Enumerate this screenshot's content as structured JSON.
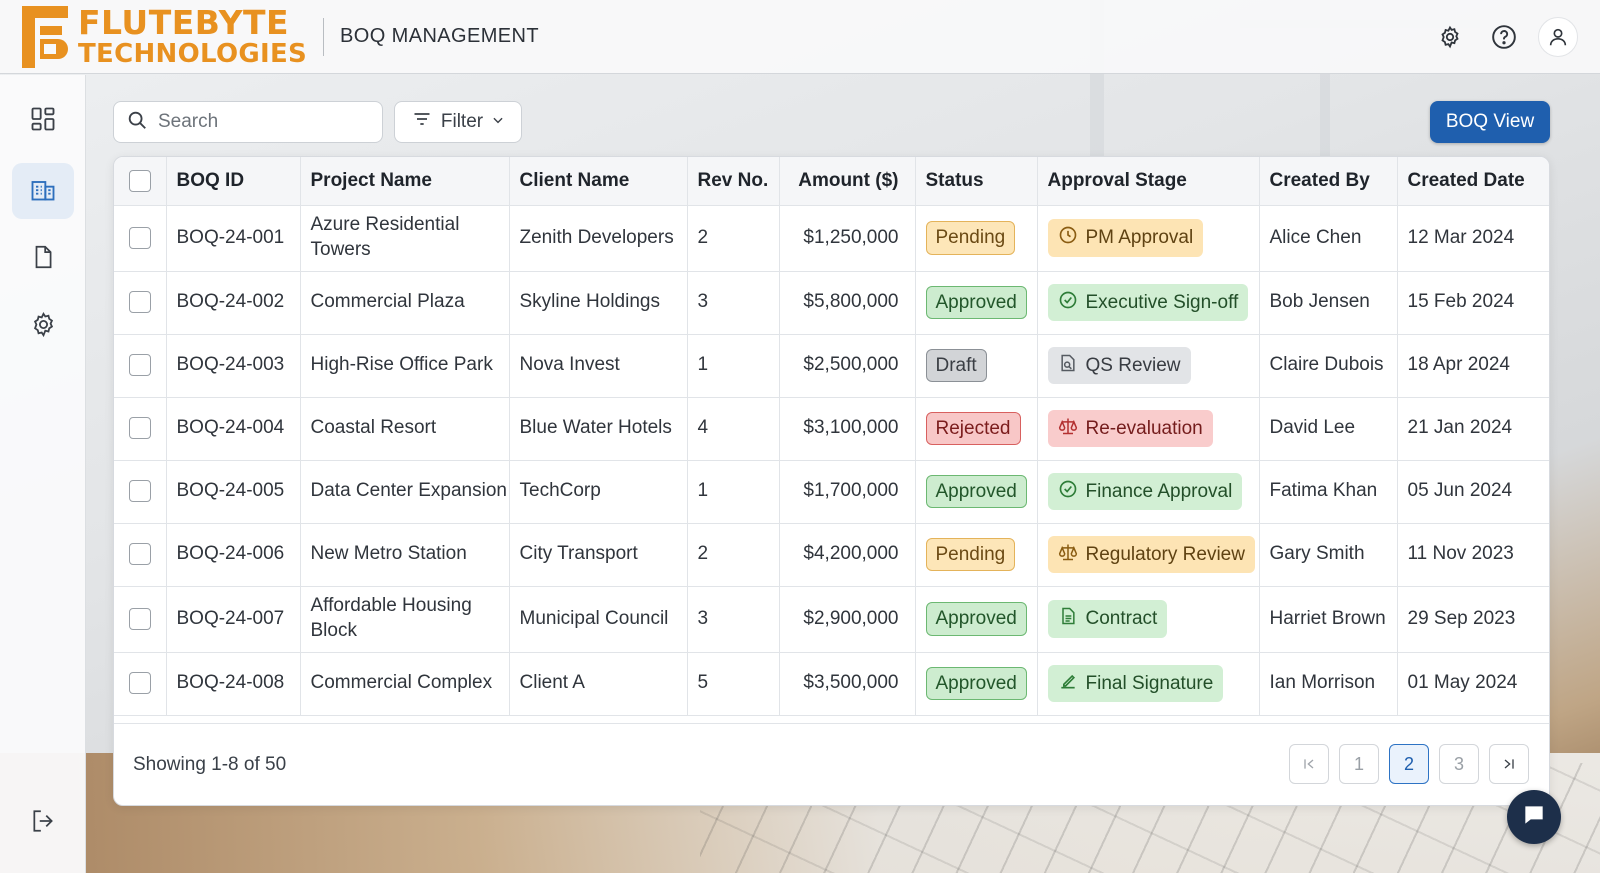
{
  "brand": {
    "line1": "FLUTEBYTE",
    "line2": "TECHNOLOGIES",
    "color": "#e89120"
  },
  "header": {
    "title": "BOQ MANAGEMENT",
    "icons": [
      "settings-icon",
      "help-icon",
      "user-icon"
    ]
  },
  "sidebar": {
    "items": [
      {
        "icon": "dashboard-icon",
        "active": false
      },
      {
        "icon": "building-icon",
        "active": true
      },
      {
        "icon": "document-icon",
        "active": false
      },
      {
        "icon": "settings-icon",
        "active": false
      }
    ],
    "bottom_icon": "logout-icon"
  },
  "toolbar": {
    "search_placeholder": "Search",
    "filter_label": "Filter",
    "view_label": "BOQ View",
    "accent": "#1f5fae"
  },
  "table": {
    "columns": [
      "BOQ ID",
      "Project Name",
      "Client Name",
      "Rev No.",
      "Amount ($)",
      "Status",
      "Approval Stage",
      "Created By",
      "Created Date"
    ],
    "rows": [
      {
        "id": "BOQ-24-001",
        "project": "Azure Residential Towers",
        "client": "Zenith Developers",
        "rev": "2",
        "amount": "$1,250,000",
        "status": "Pending",
        "status_kind": "pending",
        "stage": "PM Approval",
        "stage_kind": "amber",
        "stage_icon": "clock-icon",
        "created_by": "Alice Chen",
        "date": "12 Mar 2024"
      },
      {
        "id": "BOQ-24-002",
        "project": "Commercial Plaza",
        "client": "Skyline Holdings",
        "rev": "3",
        "amount": "$5,800,000",
        "status": "Approved",
        "status_kind": "approved",
        "stage": "Executive Sign-off",
        "stage_kind": "green",
        "stage_icon": "check-circle-icon",
        "created_by": "Bob Jensen",
        "date": "15 Feb 2024"
      },
      {
        "id": "BOQ-24-003",
        "project": "High-Rise Office Park",
        "client": "Nova Invest",
        "rev": "1",
        "amount": "$2,500,000",
        "status": "Draft",
        "status_kind": "draft",
        "stage": "QS Review",
        "stage_kind": "gray",
        "stage_icon": "document-search-icon",
        "created_by": "Claire Dubois",
        "date": "18 Apr 2024"
      },
      {
        "id": "BOQ-24-004",
        "project": "Coastal Resort",
        "client": "Blue Water Hotels",
        "rev": "4",
        "amount": "$3,100,000",
        "status": "Rejected",
        "status_kind": "rejected",
        "stage": "Re-evaluation",
        "stage_kind": "red",
        "stage_icon": "scale-icon",
        "created_by": "David Lee",
        "date": "21 Jan 2024"
      },
      {
        "id": "BOQ-24-005",
        "project": "Data Center Expansion",
        "client": "TechCorp",
        "rev": "1",
        "amount": "$1,700,000",
        "status": "Approved",
        "status_kind": "approved",
        "stage": "Finance Approval",
        "stage_kind": "green",
        "stage_icon": "check-circle-icon",
        "created_by": "Fatima Khan",
        "date": "05 Jun 2024"
      },
      {
        "id": "BOQ-24-006",
        "project": "New Metro Station",
        "client": "City Transport",
        "rev": "2",
        "amount": "$4,200,000",
        "status": "Pending",
        "status_kind": "pending",
        "stage": "Regulatory Review",
        "stage_kind": "amber",
        "stage_icon": "scale-icon",
        "created_by": "Gary Smith",
        "date": "11 Nov 2023"
      },
      {
        "id": "BOQ-24-007",
        "project": "Affordable Housing Block",
        "client": "Municipal Council",
        "rev": "3",
        "amount": "$2,900,000",
        "status": "Approved",
        "status_kind": "approved",
        "stage": "Contract",
        "stage_kind": "green",
        "stage_icon": "document-icon",
        "created_by": "Harriet Brown",
        "date": "29 Sep 2023"
      },
      {
        "id": "BOQ-24-008",
        "project": "Commercial Complex",
        "client": "Client A",
        "rev": "5",
        "amount": "$3,500,000",
        "status": "Approved",
        "status_kind": "approved",
        "stage": "Final Signature",
        "stage_kind": "green",
        "stage_icon": "pen-icon",
        "created_by": "Ian Morrison",
        "date": "01 May 2024"
      }
    ]
  },
  "footer": {
    "showing": "Showing 1-8 of 50",
    "pages": [
      "1",
      "2",
      "3"
    ],
    "current_page": "2"
  }
}
